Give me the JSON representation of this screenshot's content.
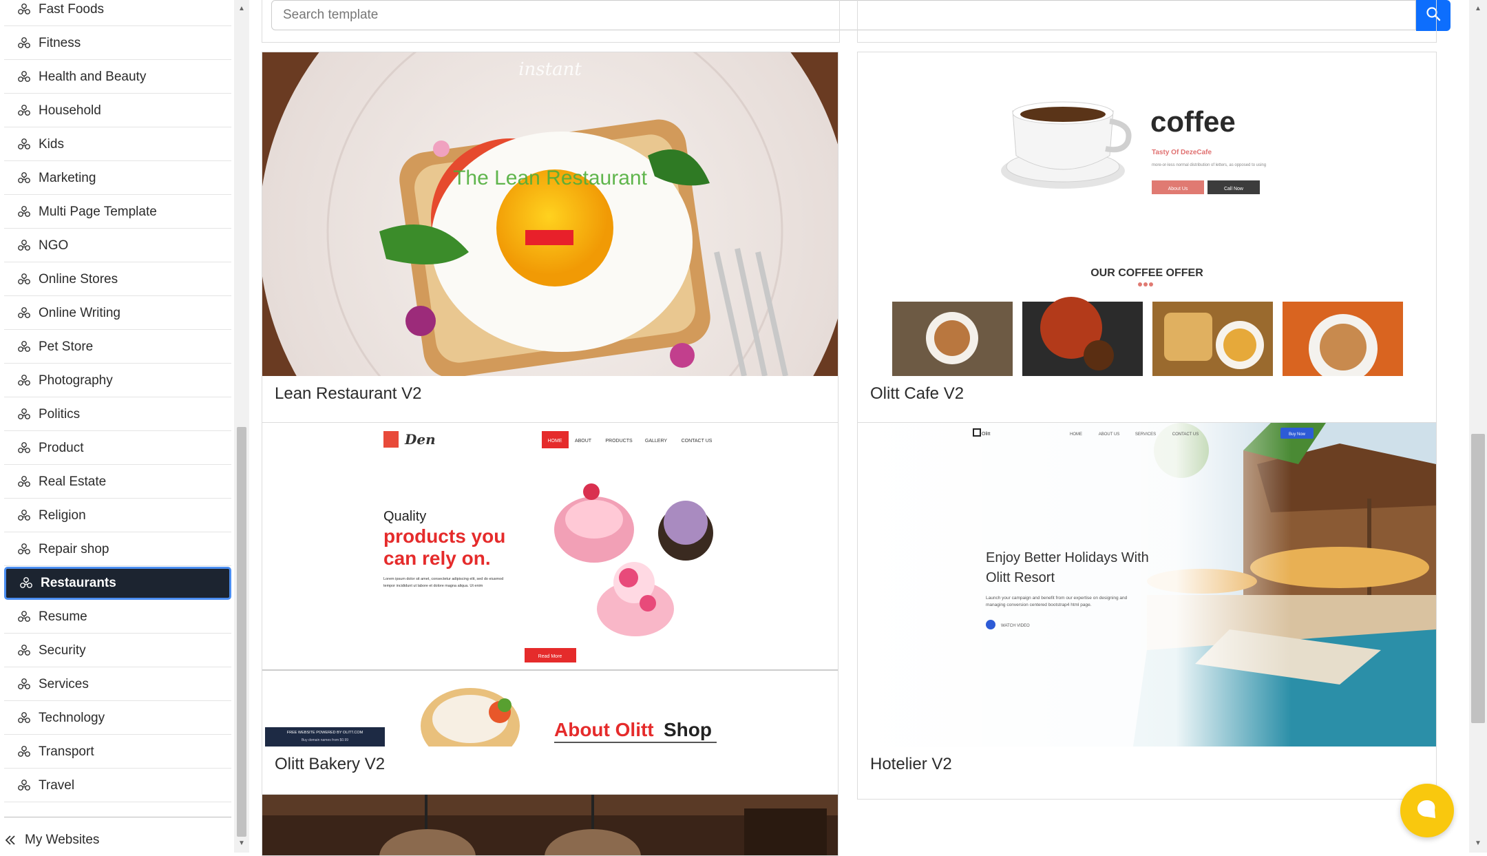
{
  "sidebar": {
    "categories": [
      {
        "label": "Fast Foods",
        "active": false
      },
      {
        "label": "Fitness",
        "active": false
      },
      {
        "label": "Health and Beauty",
        "active": false
      },
      {
        "label": "Household",
        "active": false
      },
      {
        "label": "Kids",
        "active": false
      },
      {
        "label": "Marketing",
        "active": false
      },
      {
        "label": "Multi Page Template",
        "active": false
      },
      {
        "label": "NGO",
        "active": false
      },
      {
        "label": "Online Stores",
        "active": false
      },
      {
        "label": "Online Writing",
        "active": false
      },
      {
        "label": "Pet Store",
        "active": false
      },
      {
        "label": "Photography",
        "active": false
      },
      {
        "label": "Politics",
        "active": false
      },
      {
        "label": "Product",
        "active": false
      },
      {
        "label": "Real Estate",
        "active": false
      },
      {
        "label": "Religion",
        "active": false
      },
      {
        "label": "Repair shop",
        "active": false
      },
      {
        "label": "Restaurants",
        "active": true
      },
      {
        "label": "Resume",
        "active": false
      },
      {
        "label": "Security",
        "active": false
      },
      {
        "label": "Services",
        "active": false
      },
      {
        "label": "Technology",
        "active": false
      },
      {
        "label": "Transport",
        "active": false
      },
      {
        "label": "Travel",
        "active": false
      }
    ],
    "my_websites_label": "My Websites"
  },
  "search": {
    "placeholder": "Search template"
  },
  "templates": [
    {
      "title": "Lean Restaurant V2",
      "preview": {
        "script_text": "instant",
        "heading": "The Lean Restaurant"
      }
    },
    {
      "title": "Olitt Cafe V2",
      "preview": {
        "heading": "coffee",
        "subheading": "Tasty Of DezeCafe",
        "blurb": "more-or-less normal distribution of letters, as opposed to using",
        "btn_primary": "About Us",
        "btn_secondary": "Call Now",
        "section_title": "OUR COFFEE OFFER"
      }
    },
    {
      "title": "Olitt Bakery V2",
      "preview": {
        "logo": "Den",
        "nav": [
          "HOME",
          "ABOUT",
          "PRODUCTS",
          "GALLERY",
          "CONTACT US"
        ],
        "line1": "Quality",
        "line2": "products you",
        "line3": "can rely on.",
        "blurb1": "Lorem ipsum dolor sit amet, consectetur adipiscing elit, sed do eiusmod",
        "blurb2": "tempor incididunt ut labore et dolore magna aliqua. Ut enim",
        "btn": "Read More",
        "banner1": "FREE WEBSITE POWERED BY OLITT.COM",
        "banner2": "Buy domain names from $0.99",
        "about_red": "About Olitt",
        "about_dark": "Shop"
      }
    },
    {
      "title": "Hotelier V2",
      "preview": {
        "logo": "Olitt",
        "nav": [
          "HOME",
          "ABOUT US",
          "SERVICES",
          "CONTACT US"
        ],
        "btn": "Buy Now",
        "heading1": "Enjoy Better Holidays With",
        "heading2": "Olitt Resort",
        "blurb1": "Launch your campaign and benefit from our expertise on designing and",
        "blurb2": "managing conversion centered bootstrap4 html page.",
        "watch": "WATCH VIDEO"
      }
    }
  ],
  "colors": {
    "accent": "#0d6efd",
    "active_bg": "#1c2430",
    "active_border": "#4a8df0",
    "chat": "#f9c80e",
    "bakery_red": "#e52b2b"
  }
}
